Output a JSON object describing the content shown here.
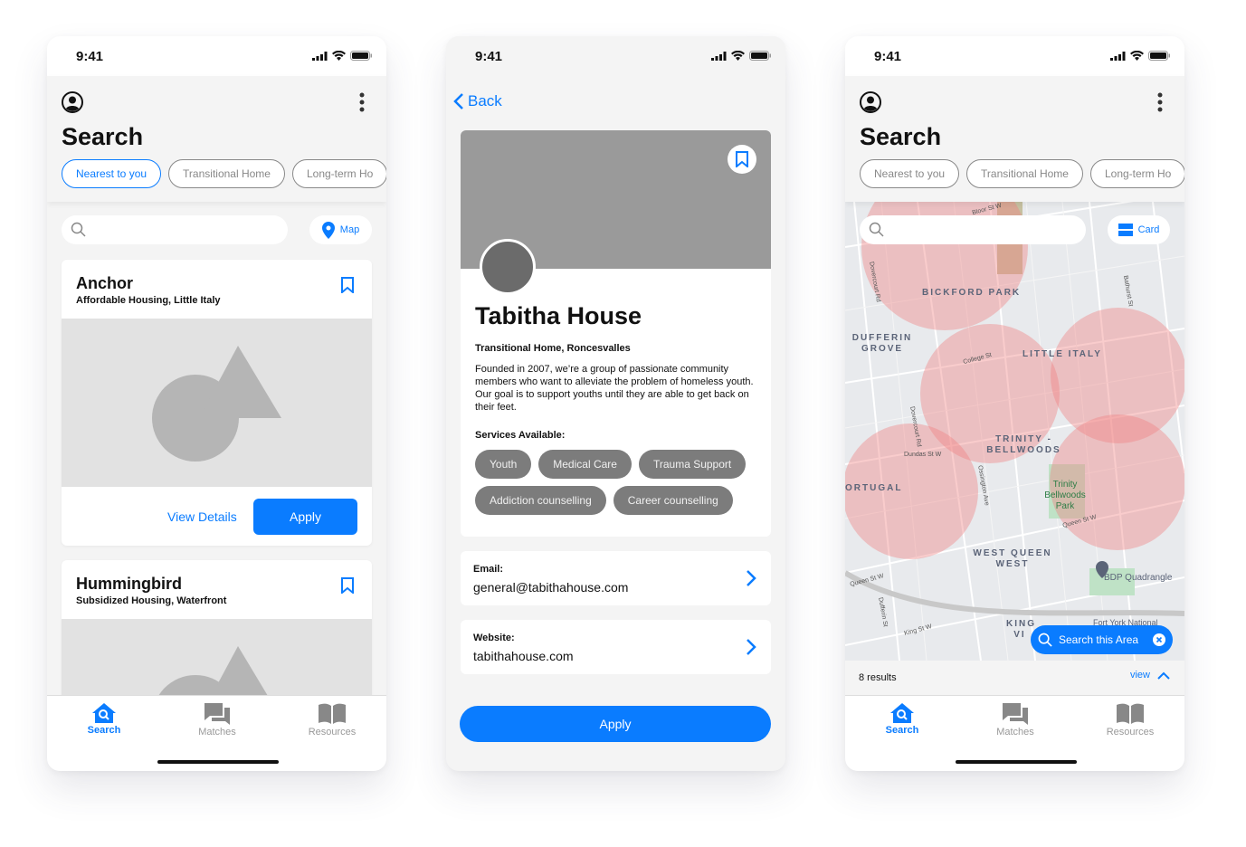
{
  "status": {
    "time": "9:41"
  },
  "search_screen": {
    "title": "Search",
    "chips": [
      "Nearest to you",
      "Transitional Home",
      "Long-term Ho"
    ],
    "map_button": "Map",
    "cards": [
      {
        "name": "Anchor",
        "subtitle": "Affordable Housing, Little Italy",
        "view_details": "View Details",
        "apply": "Apply"
      },
      {
        "name": "Hummingbird",
        "subtitle": "Subsidized Housing, Waterfront"
      }
    ]
  },
  "detail_screen": {
    "back": "Back",
    "title": "Tabitha House",
    "subtitle": "Transitional Home, Roncesvalles",
    "description": "Founded in 2007, we’re a group of passionate community members who want to alleviate the problem of homeless youth. Our goal is to support youths until they are able to get back on their feet.",
    "services_label": "Services Available:",
    "services": [
      "Youth",
      "Medical Care",
      "Trauma Support",
      "Addiction counselling",
      "Career counselling"
    ],
    "email_label": "Email:",
    "email": "general@tabithahouse.com",
    "website_label": "Website:",
    "website": "tabithahouse.com",
    "apply": "Apply"
  },
  "map_screen": {
    "title": "Search",
    "chips": [
      "Nearest to you",
      "Transitional Home",
      "Long-term Ho"
    ],
    "card_button": "Card",
    "search_area": "Search this Area",
    "results": "8 results",
    "view": "view",
    "labels": {
      "bickford": "BICKFORD PARK",
      "dufferin": "DUFFERIN GROVE",
      "little_italy": "LITTLE ITALY",
      "trinity": "TRINITY - BELLWOODS",
      "portugal": "ORTUGAL",
      "wqw": "WEST QUEEN WEST",
      "park": "Trinity Bellwoods Park",
      "bdp": "BDP Quadrangle",
      "fort_york": "Fort York National",
      "king": "KING VI",
      "college": "College St",
      "dundas": "Dundas St W",
      "queen": "Queen St W",
      "queen2": "Queen St W",
      "king_st": "King St W",
      "bloor": "Bloor St W",
      "dovercourt": "Dovercourt Rd",
      "dovercourt2": "Dovercourt Rd",
      "bathurst": "Bathurst St",
      "ossington": "Ossington Ave",
      "dufferin_st": "Dufferin St"
    }
  },
  "nav": {
    "search": "Search",
    "matches": "Matches",
    "resources": "Resources"
  },
  "colors": {
    "accent": "#0a7cff",
    "zone": "#f08080"
  }
}
